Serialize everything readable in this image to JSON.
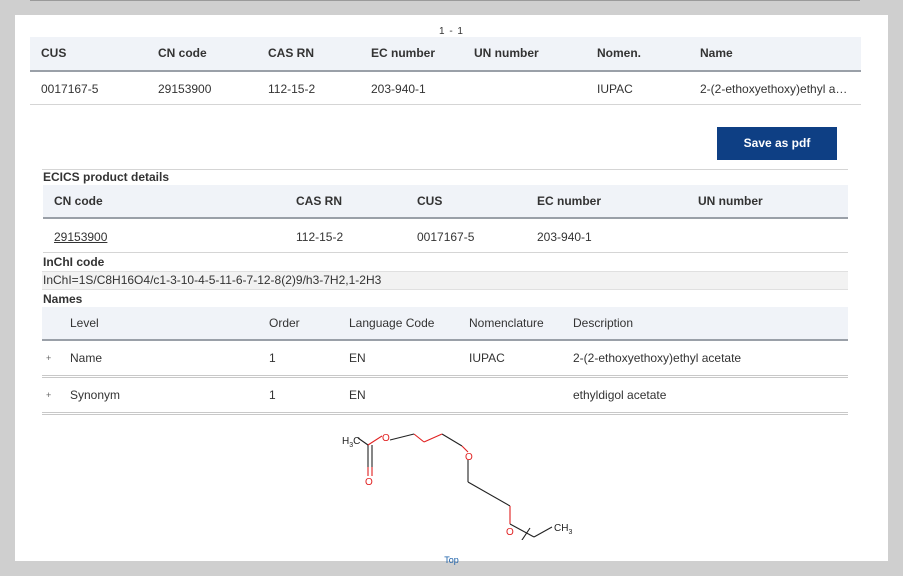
{
  "pager": "1 - 1",
  "results": {
    "headers": [
      "CUS",
      "CN code",
      "CAS RN",
      "EC number",
      "UN number",
      "Nomen.",
      "Name"
    ],
    "row": {
      "cus": "0017167-5",
      "cn_code": "29153900",
      "cas_rn": "112-15-2",
      "ec_number": "203-940-1",
      "un_number": "",
      "nomen": "IUPAC",
      "name": "2-(2-ethoxyethoxy)ethyl a…"
    }
  },
  "save_pdf_label": "Save as pdf",
  "product_details": {
    "title": "ECICS product details",
    "headers": [
      "CN code",
      "CAS RN",
      "CUS",
      "EC number",
      "UN number"
    ],
    "row": {
      "cn_code": "29153900",
      "cas_rn": "112-15-2",
      "cus": "0017167-5",
      "ec_number": "203-940-1",
      "un_number": ""
    }
  },
  "inchi": {
    "title": "InChI code",
    "value": "InChI=1S/C8H16O4/c1-3-10-4-5-11-6-7-12-8(2)9/h3-7H2,1-2H3"
  },
  "names": {
    "title": "Names",
    "headers": [
      "Level",
      "Order",
      "Language Code",
      "Nomenclature",
      "Description"
    ],
    "rows": [
      {
        "expand": "+",
        "level": "Name",
        "order": "1",
        "lang": "EN",
        "nomenclature": "IUPAC",
        "description": "2-(2-ethoxyethoxy)ethyl acetate"
      },
      {
        "expand": "+",
        "level": "Synonym",
        "order": "1",
        "lang": "EN",
        "nomenclature": "",
        "description": "ethyldigol acetate"
      }
    ]
  },
  "structure": {
    "left_group": {
      "atom": "H",
      "count": "3",
      "atom2": "C"
    },
    "right_group": {
      "atom": "CH",
      "count": "3"
    },
    "oxygen_symbol": "O"
  },
  "top_link": "Top",
  "colors": {
    "link": "#1a1fb0",
    "button": "#0e3f84",
    "header_bg": "#f0f3f8",
    "oxygen": "#e02020"
  }
}
